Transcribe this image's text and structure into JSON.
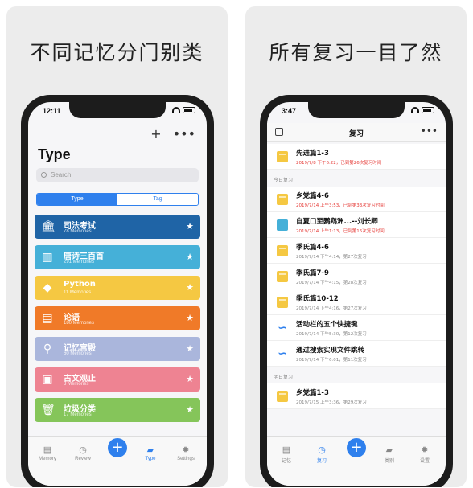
{
  "left": {
    "headline": "不同记忆分门别类",
    "status": {
      "time": "12:11"
    },
    "top_icons": {
      "add": "+",
      "more": "•••"
    },
    "page_title": "Type",
    "search": {
      "placeholder": "Search"
    },
    "segments": [
      "Type",
      "Tag"
    ],
    "cards": [
      {
        "title": "司法考试",
        "subtitle": "78 Memories",
        "color": "#1f64a6",
        "icon": "bank-icon",
        "glyph": "🏛",
        "star": "★"
      },
      {
        "title": "唐诗三百首",
        "subtitle": "291 Memories",
        "color": "#45b0d8",
        "icon": "book-icon",
        "glyph": "▥",
        "star": "★"
      },
      {
        "title": "Python",
        "subtitle": "11 Memories",
        "color": "#f5c842",
        "icon": "python-icon",
        "glyph": "◆",
        "star": "★"
      },
      {
        "title": "论语",
        "subtitle": "180 Memories",
        "color": "#f07a28",
        "icon": "tablet-icon",
        "glyph": "▤",
        "star": "★"
      },
      {
        "title": "记忆宫殿",
        "subtitle": "60 Memories",
        "color": "#aab6dc",
        "icon": "pin-icon",
        "glyph": "⚲",
        "star": "★"
      },
      {
        "title": "古文观止",
        "subtitle": "3 Memories",
        "color": "#ee8392",
        "icon": "image-icon",
        "glyph": "▣",
        "star": "★"
      },
      {
        "title": "垃圾分类",
        "subtitle": "17 Memories",
        "color": "#85c55a",
        "icon": "trash-icon",
        "glyph": "🗑",
        "star": "★"
      }
    ],
    "tabs": [
      {
        "label": "Memory",
        "glyph": "▤"
      },
      {
        "label": "Review",
        "glyph": "◷"
      },
      {
        "label": "Type",
        "glyph": "▰"
      },
      {
        "label": "Settings",
        "glyph": "✹"
      }
    ],
    "fab": "+"
  },
  "right": {
    "headline": "所有复习一目了然",
    "status": {
      "time": "3:47"
    },
    "title": "复习",
    "more": "•••",
    "top_item": {
      "title": "先进篇1-3",
      "subtitle": "2019/7/8 下午6:22，已到第26次复习时间"
    },
    "section_today": "今日复习",
    "today_items": [
      {
        "title": "乡党篇4-6",
        "subtitle": "2019/7/14 上午3:53，已到第33次复习时间",
        "red": true,
        "icon": "folder"
      },
      {
        "title": "自夏口至鹦鹉洲...--刘长卿",
        "subtitle": "2019/7/14 上午1:13，已到第16次复习时间",
        "red": true,
        "icon": "book"
      },
      {
        "title": "季氏篇4-6",
        "subtitle": "2019/7/14 下午4:14，第27次复习",
        "red": false,
        "icon": "folder"
      },
      {
        "title": "季氏篇7-9",
        "subtitle": "2019/7/14 下午4:15，第28次复习",
        "red": false,
        "icon": "folder"
      },
      {
        "title": "季氏篇10-12",
        "subtitle": "2019/7/14 下午4:16，第27次复习",
        "red": false,
        "icon": "folder"
      },
      {
        "title": "活动栏的五个快捷键",
        "subtitle": "2019/7/14 下午5:30，第12次复习",
        "red": false,
        "icon": "link"
      },
      {
        "title": "通过搜索实现文件跳转",
        "subtitle": "2019/7/14 下午6:01，第11次复习",
        "red": false,
        "icon": "link"
      }
    ],
    "section_tomorrow": "明日复习",
    "tomorrow_items": [
      {
        "title": "乡党篇1-3",
        "subtitle": "2019/7/15 上午3:36，第29次复习",
        "red": false,
        "icon": "folder"
      }
    ],
    "tabs": [
      {
        "label": "记忆",
        "glyph": "▤"
      },
      {
        "label": "复习",
        "glyph": "◷"
      },
      {
        "label": "类别",
        "glyph": "▰"
      },
      {
        "label": "设置",
        "glyph": "✹"
      }
    ],
    "fab": "+"
  }
}
